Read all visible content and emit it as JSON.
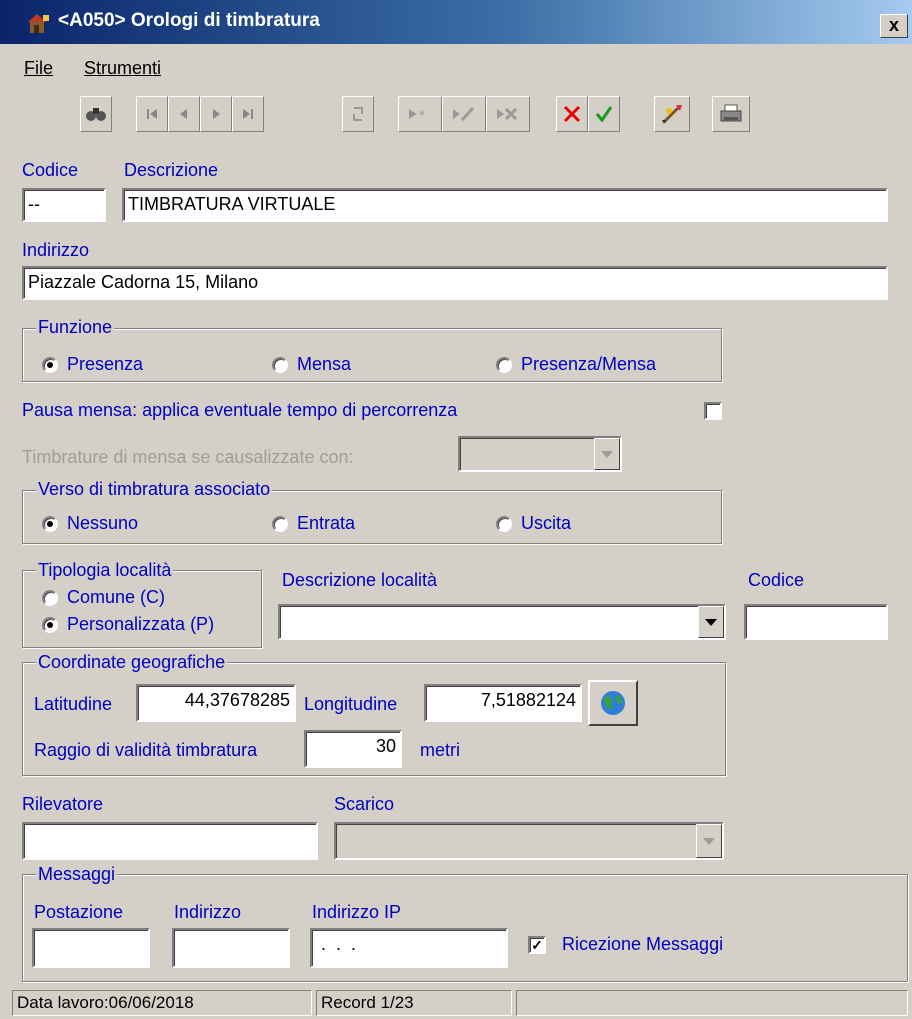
{
  "window": {
    "title": "<A050> Orologi di timbratura",
    "close_label": "x"
  },
  "menu": {
    "file": "File",
    "strumenti": "Strumenti"
  },
  "toolbar": {
    "buttons": [
      "search-icon",
      "first-icon",
      "prev-icon",
      "next-icon",
      "last-icon",
      "refresh-icon",
      "new-record-icon",
      "edit-record-icon",
      "delete-record-icon",
      "cancel-icon",
      "confirm-icon",
      "tools-icon",
      "print-icon"
    ]
  },
  "form": {
    "codice_label": "Codice",
    "codice_value": "--",
    "descrizione_label": "Descrizione",
    "descrizione_value": "TIMBRATURA VIRTUALE",
    "indirizzo_label": "Indirizzo",
    "indirizzo_value": "Piazzale Cadorna 15, Milano",
    "funzione": {
      "legend": "Funzione",
      "options": [
        "Presenza",
        "Mensa",
        "Presenza/Mensa"
      ],
      "selected": "Presenza"
    },
    "pausa_label": "Pausa mensa: applica eventuale tempo di percorrenza",
    "pausa_checked": false,
    "timbrature_mensa_label": "Timbrature di mensa se causalizzate con:",
    "timbrature_mensa_value": "",
    "verso": {
      "legend": "Verso di timbratura associato",
      "options": [
        "Nessuno",
        "Entrata",
        "Uscita"
      ],
      "selected": "Nessuno"
    },
    "tipologia": {
      "legend": "Tipologia località",
      "options": [
        "Comune (C)",
        "Personalizzata (P)"
      ],
      "selected": "Personalizzata (P)"
    },
    "descrizione_localita_label": "Descrizione località",
    "descrizione_localita_value": "",
    "codice_localita_label": "Codice",
    "codice_localita_value": "",
    "coordinate": {
      "legend": "Coordinate geografiche",
      "latitudine_label": "Latitudine",
      "latitudine_value": "44,37678285",
      "longitudine_label": "Longitudine",
      "longitudine_value": "7,51882124",
      "raggio_label": "Raggio di validità timbratura",
      "raggio_value": "30",
      "raggio_unit": "metri"
    },
    "rilevatore_label": "Rilevatore",
    "rilevatore_value": "",
    "scarico_label": "Scarico",
    "scarico_value": "",
    "messaggi": {
      "legend": "Messaggi",
      "postazione_label": "Postazione",
      "postazione_value": "",
      "indirizzo_label": "Indirizzo",
      "indirizzo_value": "",
      "ip_label": "Indirizzo IP",
      "ip_value": " .  .  . ",
      "ricezione_label": "Ricezione Messaggi",
      "ricezione_checked": true
    }
  },
  "status": {
    "data_lavoro": "Data lavoro:06/06/2018",
    "record": "Record 1/23",
    "extra": ""
  }
}
